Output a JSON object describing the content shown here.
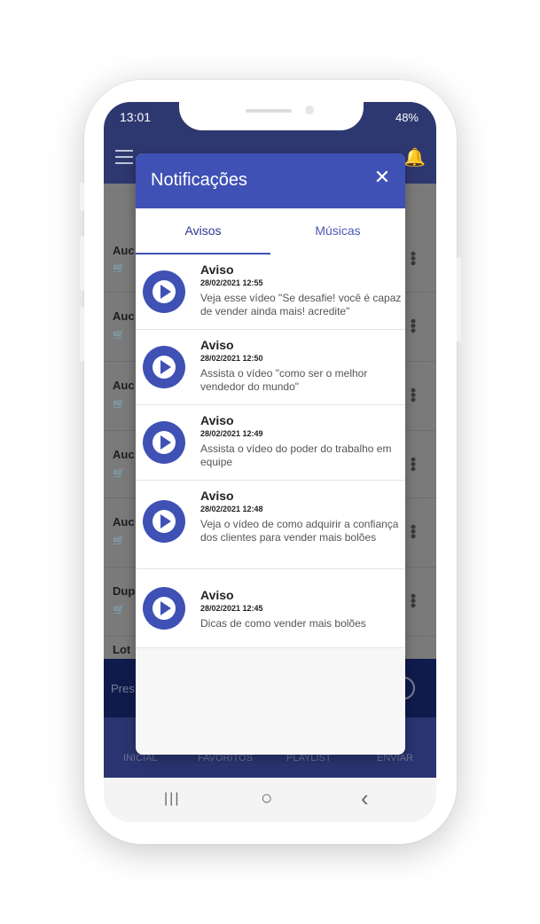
{
  "status": {
    "time": "13:01",
    "battery": "48%"
  },
  "app": {
    "list_rows": [
      {
        "title": "Auc"
      },
      {
        "title": "Auc"
      },
      {
        "title": "Auc"
      },
      {
        "title": "Auc"
      },
      {
        "title": "Auc"
      },
      {
        "title": "Dup"
      },
      {
        "title": "Lot"
      }
    ],
    "player_label": "Pres",
    "bottom_nav": [
      "INICIAL",
      "FAVORITOS",
      "PLAYLIST",
      "ENVIAR"
    ]
  },
  "modal": {
    "title": "Notificações",
    "close_glyph": "✕",
    "tabs": [
      {
        "label": "Avisos"
      },
      {
        "label": "Músicas"
      }
    ],
    "notifications": [
      {
        "title": "Aviso",
        "date": "28/02/2021 12:55",
        "body": "Veja esse vídeo \"Se desafie! você é capaz de vender ainda mais! acredite\""
      },
      {
        "title": "Aviso",
        "date": "28/02/2021 12:50",
        "body": "Assista o vídeo \"como ser o melhor vendedor do mundo\""
      },
      {
        "title": "Aviso",
        "date": "28/02/2021 12:49",
        "body": "Assista o vídeo do poder do trabalho em equipe"
      },
      {
        "title": "Aviso",
        "date": "28/02/2021 12:48",
        "body": "Veja o vídeo de como adquirir a confiança dos clientes para vender mais bolões"
      },
      {
        "title": "Aviso",
        "date": "28/02/2021 12:45",
        "body": "Dicas de como vender mais bolões"
      }
    ]
  },
  "system_nav": {
    "recents": "|||",
    "home": "○",
    "back": "‹"
  }
}
